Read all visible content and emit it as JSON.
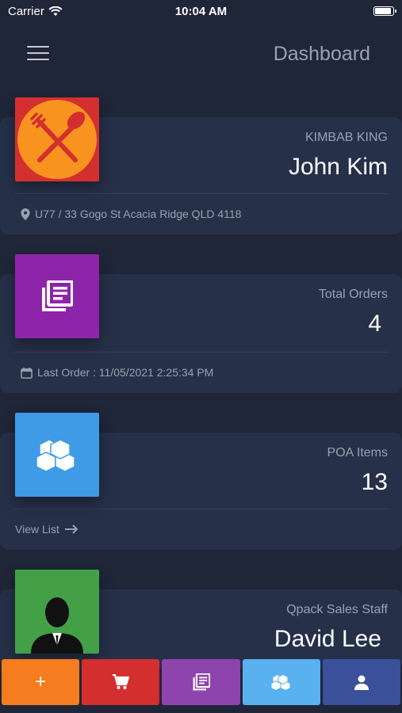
{
  "status": {
    "carrier": "Carrier",
    "time": "10:04 AM"
  },
  "nav": {
    "title": "Dashboard",
    "menu_icon": "hamburger-menu-icon"
  },
  "cards": {
    "store": {
      "subtitle": "KIMBAB KING",
      "name": "John Kim",
      "address": "U77 / 33 Gogo St Acacia Ridge QLD 4118",
      "icon_color": "#d32f2f",
      "icon": "fork-spoon-icon"
    },
    "orders": {
      "subtitle": "Total Orders",
      "value": "4",
      "footer": "Last Order : 11/05/2021 2:25:34 PM",
      "icon_color": "#8e24aa",
      "icon": "orders-list-icon"
    },
    "poa": {
      "subtitle": "POA Items",
      "value": "13",
      "footer": "View List",
      "icon_color": "#3f9be6",
      "icon": "cubes-icon"
    },
    "staff": {
      "subtitle": "Qpack Sales Staff",
      "name": "David Lee",
      "icon_color": "#43a047",
      "icon": "staff-avatar-icon"
    }
  },
  "tabs": [
    {
      "name": "add",
      "symbol": "+",
      "color": "#f57c1f"
    },
    {
      "name": "cart",
      "color": "#d32f2f"
    },
    {
      "name": "orders",
      "color": "#8e44ad"
    },
    {
      "name": "poa-items",
      "color": "#5ab1ef"
    },
    {
      "name": "profile",
      "color": "#3a509a"
    }
  ]
}
